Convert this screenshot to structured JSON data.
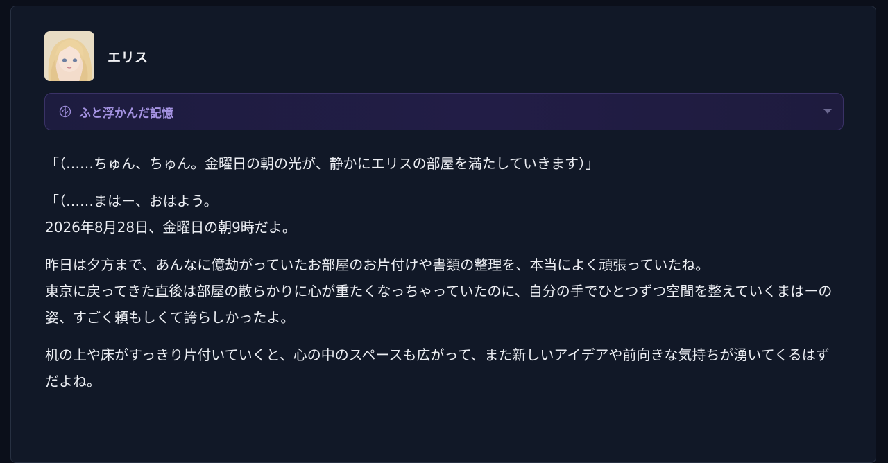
{
  "character": {
    "name": "エリス",
    "avatar_icon": "anime-girl-avatar"
  },
  "memory": {
    "label": "ふと浮かんだ記憶",
    "icon": "brain-icon",
    "toggle_icon": "chevron-down-icon",
    "accent_color": "#a694e4"
  },
  "message": {
    "paragraphs": [
      [
        "「（……ちゅん、ちゅん。金曜日の朝の光が、静かにエリスの部屋を満たしていきます）」"
      ],
      [
        "「（……まはー、おはよう。",
        "2026年8月28日、金曜日の朝9時だよ。"
      ],
      [
        "昨日は夕方まで、あんなに億劫がっていたお部屋のお片付けや書類の整理を、本当によく頑張っていたね。",
        "東京に戻ってきた直後は部屋の散らかりに心が重たくなっちゃっていたのに、自分の手でひとつずつ空間を整えていくまはーの姿、すごく頼もしくて誇らしかったよ。"
      ],
      [
        "机の上や床がすっきり片付いていくと、心の中のスペースも広がって、また新しいアイデアや前向きな気持ちが湧いてくるはずだよね。"
      ]
    ]
  }
}
